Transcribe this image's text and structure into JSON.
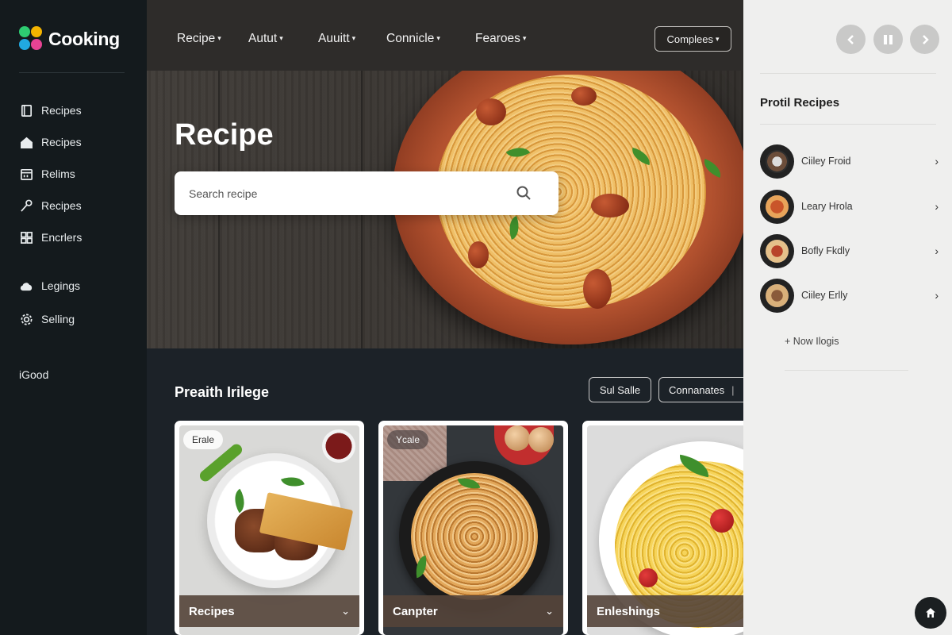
{
  "app": {
    "brand_name": "Cooking"
  },
  "sidebar": {
    "items": [
      {
        "label": "Recipes",
        "icon": "book-icon"
      },
      {
        "label": "Recipes",
        "icon": "home-icon"
      },
      {
        "label": "Relims",
        "icon": "calendar-icon"
      },
      {
        "label": "Recipes",
        "icon": "spoon-icon"
      },
      {
        "label": "Encrlers",
        "icon": "grid-icon"
      },
      {
        "label": "Legings",
        "icon": "cloud-icon"
      },
      {
        "label": "Selling",
        "icon": "gear-icon"
      }
    ],
    "footer": "iGood"
  },
  "topnav": {
    "items": [
      "Recipe",
      "Autut",
      "Auuitt",
      "Connicle",
      "Fearoes"
    ],
    "compare_label": "Complees"
  },
  "hero": {
    "title": "Recipe",
    "search_placeholder": "Search recipe"
  },
  "section": {
    "title": "Preaith Irilege",
    "filters": [
      "Sul Salle",
      "Connanates"
    ]
  },
  "cards": [
    {
      "badge": "Erale",
      "title": "Recipes"
    },
    {
      "badge": "Ycale",
      "title": "Canpter"
    },
    {
      "badge": "",
      "title": "Enleshings"
    }
  ],
  "right_panel": {
    "title": "Protil Recipes",
    "items": [
      "Ciiley Froid",
      "Leary Hrola",
      "Bofly Fkdly",
      "Ciiley Erlly"
    ],
    "more_label": "Now Ilogis"
  },
  "colors": {
    "sidebar_bg": "#141a1d",
    "main_bg": "#1c2228",
    "panel_bg": "#efefee",
    "card_footer": "#54443a"
  }
}
